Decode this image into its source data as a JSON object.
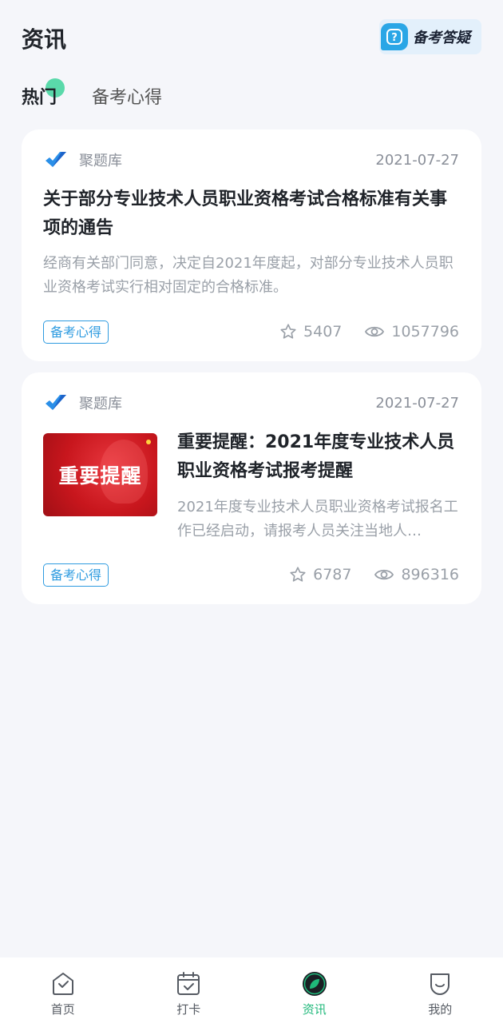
{
  "header": {
    "title": "资讯",
    "qa_label": "备考答疑"
  },
  "tabs": [
    {
      "label": "热门",
      "active": true
    },
    {
      "label": "备考心得",
      "active": false
    }
  ],
  "articles": [
    {
      "source": "聚题库",
      "date": "2021-07-27",
      "title": "关于部分专业技术人员职业资格考试合格标准有关事项的通告",
      "summary": "经商有关部门同意，决定自2021年度起，对部分专业技术人员职业资格考试实行相对固定的合格标准。",
      "tag": "备考心得",
      "favorites": "5407",
      "views": "1057796"
    },
    {
      "source": "聚题库",
      "date": "2021-07-27",
      "thumbnail_text": "重要提醒",
      "title": "重要提醒：2021年度专业技术人员职业资格考试报考提醒",
      "summary": "2021年度专业技术人员职业资格考试报名工作已经启动，请报考人员关注当地人…",
      "tag": "备考心得",
      "favorites": "6787",
      "views": "896316"
    }
  ],
  "nav": [
    {
      "label": "首页",
      "icon": "home-icon"
    },
    {
      "label": "打卡",
      "icon": "calendar-check-icon"
    },
    {
      "label": "资讯",
      "icon": "compass-icon",
      "active": true
    },
    {
      "label": "我的",
      "icon": "profile-icon"
    }
  ],
  "colors": {
    "accent": "#1fb87a",
    "tag": "#2e9be0",
    "thumbnail": "#c8161d"
  }
}
